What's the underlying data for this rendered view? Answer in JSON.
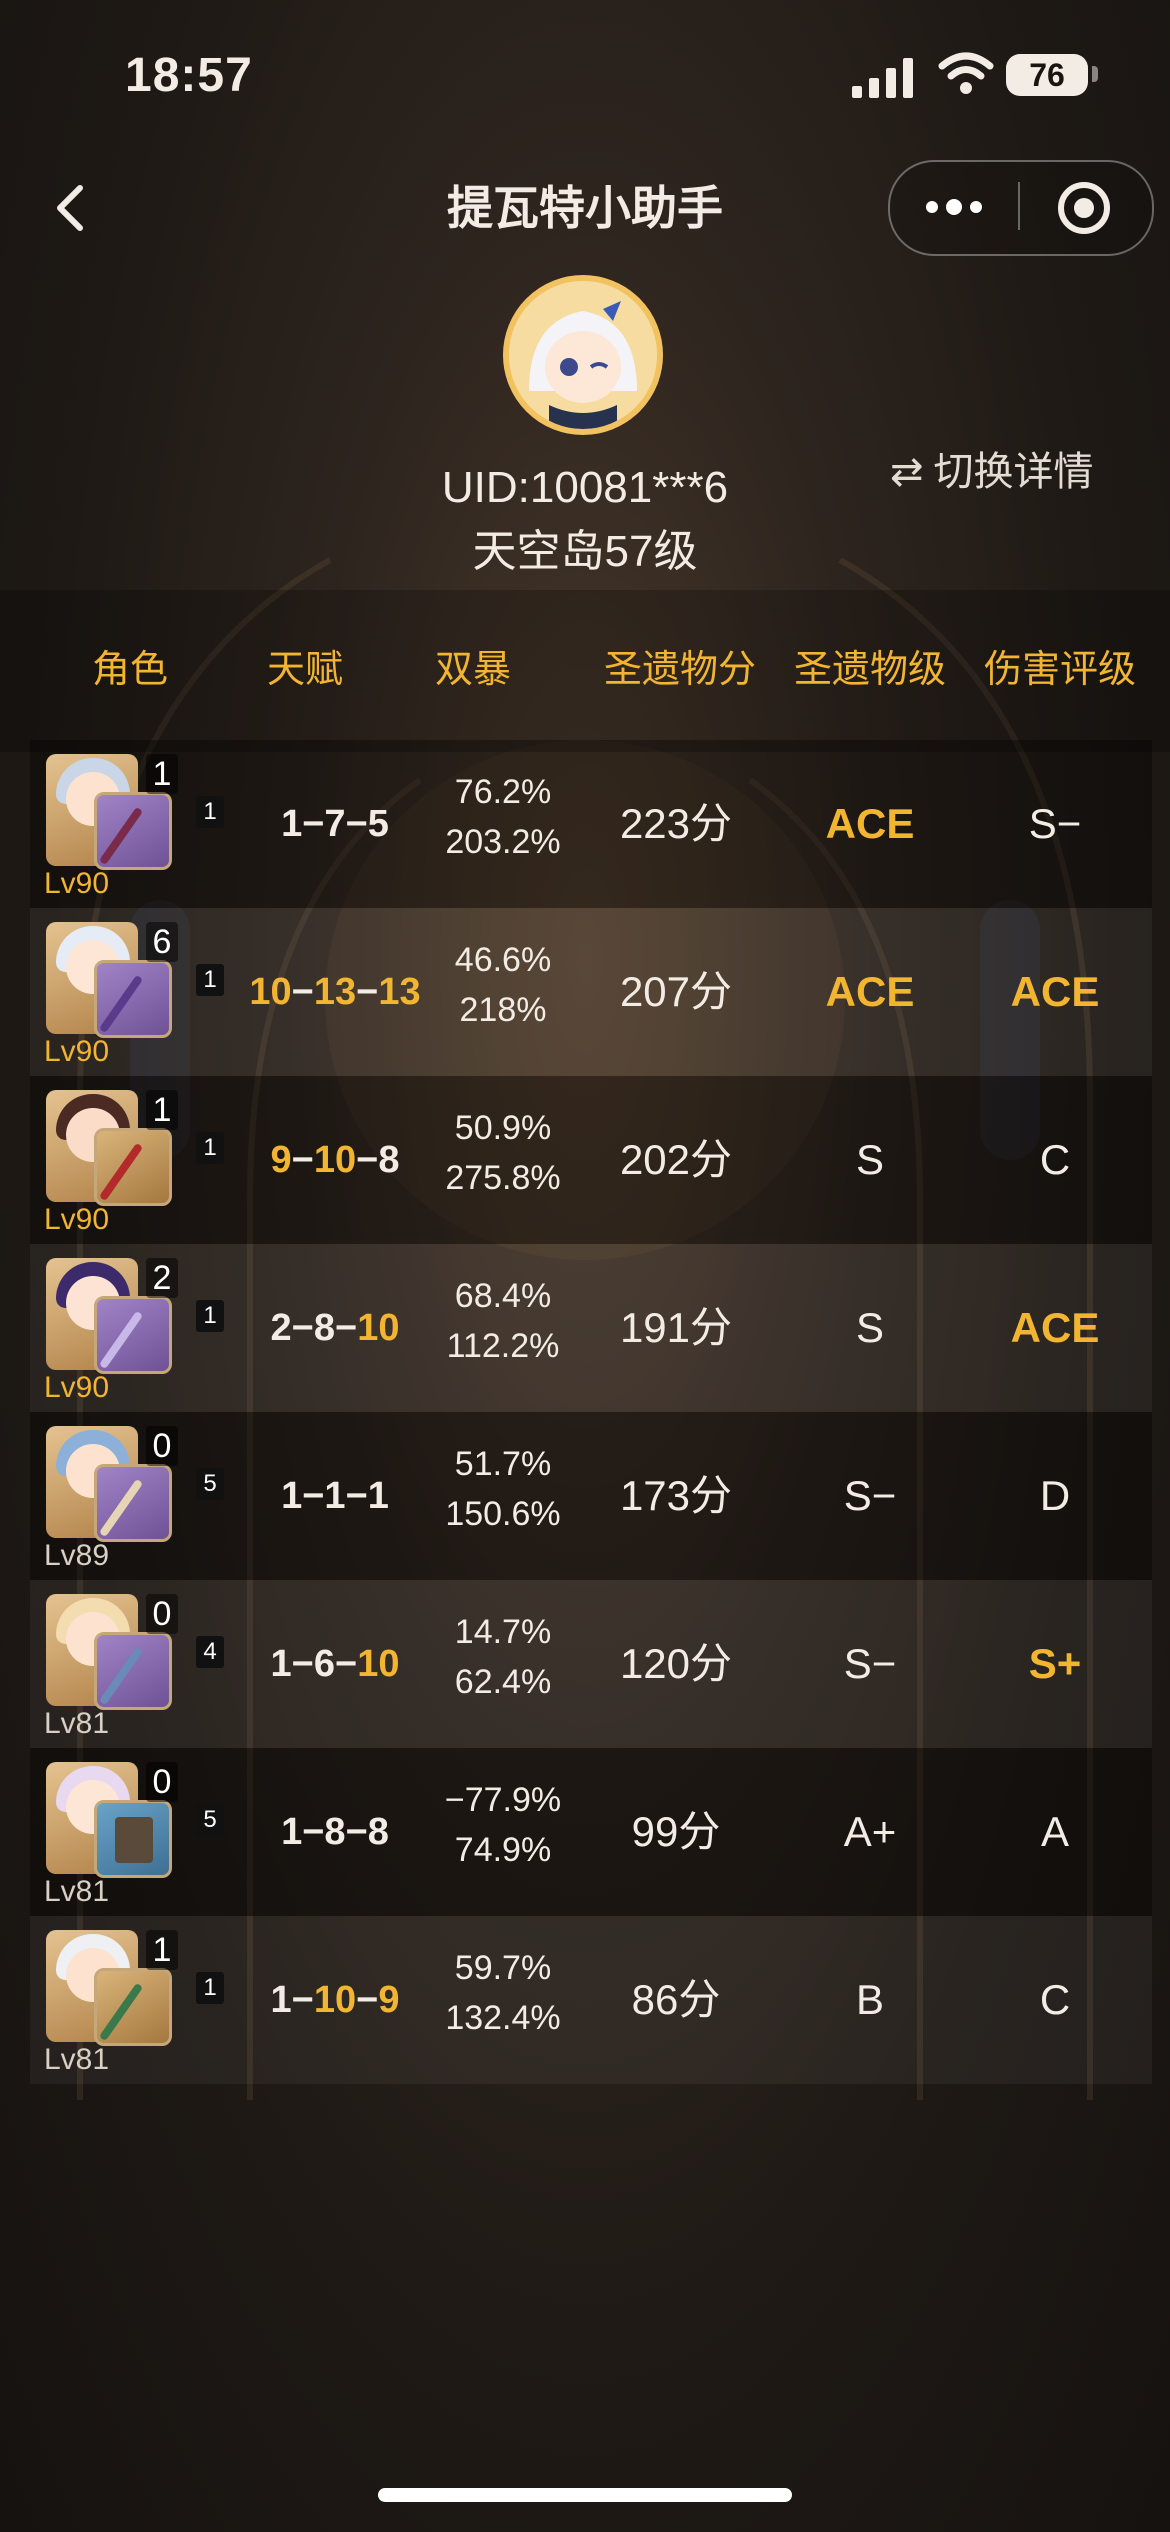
{
  "status_bar": {
    "time": "18:57",
    "battery": "76"
  },
  "nav": {
    "title": "提瓦特小助手"
  },
  "profile": {
    "uid": "UID:10081***6",
    "level": "天空岛57级",
    "switch_label": "切换详情"
  },
  "table": {
    "headers": [
      "角色",
      "天赋",
      "双暴",
      "圣遗物分",
      "圣遗物级",
      "伤害评级"
    ],
    "rows": [
      {
        "constellation": "1",
        "level": "Lv90",
        "friendship": "1",
        "talent": [
          "1",
          "7",
          "5"
        ],
        "crit_rate": "76.2%",
        "crit_dmg": "203.2%",
        "score": "223分",
        "grade": "ACE",
        "dmg_rating": "S−"
      },
      {
        "constellation": "6",
        "level": "Lv90",
        "friendship": "1",
        "talent": [
          "10",
          "13",
          "13"
        ],
        "crit_rate": "46.6%",
        "crit_dmg": "218%",
        "score": "207分",
        "grade": "ACE",
        "dmg_rating": "ACE"
      },
      {
        "constellation": "1",
        "level": "Lv90",
        "friendship": "1",
        "talent": [
          "9",
          "10",
          "8"
        ],
        "crit_rate": "50.9%",
        "crit_dmg": "275.8%",
        "score": "202分",
        "grade": "S",
        "dmg_rating": "C"
      },
      {
        "constellation": "2",
        "level": "Lv90",
        "friendship": "1",
        "talent": [
          "2",
          "8",
          "10"
        ],
        "crit_rate": "68.4%",
        "crit_dmg": "112.2%",
        "score": "191分",
        "grade": "S",
        "dmg_rating": "ACE"
      },
      {
        "constellation": "0",
        "level": "Lv89",
        "friendship": "5",
        "talent": [
          "1",
          "1",
          "1"
        ],
        "crit_rate": "51.7%",
        "crit_dmg": "150.6%",
        "score": "173分",
        "grade": "S−",
        "dmg_rating": "D"
      },
      {
        "constellation": "0",
        "level": "Lv81",
        "friendship": "4",
        "talent": [
          "1",
          "6",
          "10"
        ],
        "crit_rate": "14.7%",
        "crit_dmg": "62.4%",
        "score": "120分",
        "grade": "S−",
        "dmg_rating": "S+"
      },
      {
        "constellation": "0",
        "level": "Lv81",
        "friendship": "5",
        "talent": [
          "1",
          "8",
          "8"
        ],
        "crit_rate": "−77.9%",
        "crit_dmg": "74.9%",
        "score": "99分",
        "grade": "A+",
        "dmg_rating": "A"
      },
      {
        "constellation": "1",
        "level": "Lv81",
        "friendship": "1",
        "talent": [
          "1",
          "10",
          "9"
        ],
        "crit_rate": "59.7%",
        "crit_dmg": "132.4%",
        "score": "86分",
        "grade": "B",
        "dmg_rating": "C"
      }
    ]
  },
  "colors": {
    "accent": "#f2b531",
    "text": "#f2ece4",
    "background": "#1e1915"
  }
}
